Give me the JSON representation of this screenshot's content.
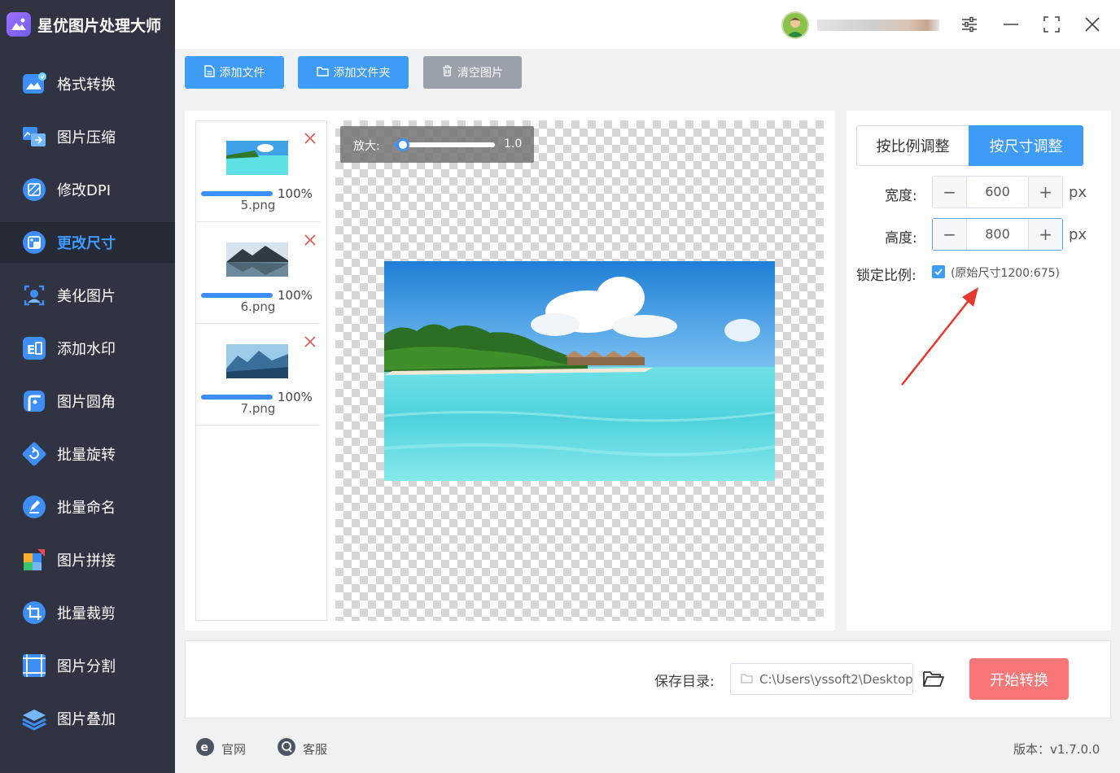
{
  "app": {
    "title": "星优图片处理大师",
    "accent": "#3e9bf6",
    "sidebar_bg": "#2f3342"
  },
  "sidebar": {
    "items": [
      {
        "label": "格式转换",
        "icon": "image-convert-icon"
      },
      {
        "label": "图片压缩",
        "icon": "image-compress-icon"
      },
      {
        "label": "修改DPI",
        "icon": "dpi-icon"
      },
      {
        "label": "更改尺寸",
        "icon": "resize-icon",
        "active": true
      },
      {
        "label": "美化图片",
        "icon": "beautify-icon"
      },
      {
        "label": "添加水印",
        "icon": "watermark-icon"
      },
      {
        "label": "图片圆角",
        "icon": "rounded-corner-icon"
      },
      {
        "label": "批量旋转",
        "icon": "rotate-icon"
      },
      {
        "label": "批量命名",
        "icon": "rename-icon"
      },
      {
        "label": "图片拼接",
        "icon": "puzzle-icon"
      },
      {
        "label": "批量裁剪",
        "icon": "crop-icon"
      },
      {
        "label": "图片分割",
        "icon": "split-icon"
      },
      {
        "label": "图片叠加",
        "icon": "layers-icon"
      }
    ]
  },
  "toolbar": {
    "add_file": "添加文件",
    "add_folder": "添加文件夹",
    "clear": "清空图片"
  },
  "files": [
    {
      "name": "5.png",
      "progress": "100%",
      "progress_value": 1.0
    },
    {
      "name": "6.png",
      "progress": "100%",
      "progress_value": 1.0
    },
    {
      "name": "7.png",
      "progress": "100%",
      "progress_value": 1.0
    }
  ],
  "zoom": {
    "label": "放大:",
    "value": "1.0"
  },
  "settings": {
    "tab_ratio": "按比例调整",
    "tab_size": "按尺寸调整",
    "width_label": "宽度:",
    "width_value": "600",
    "height_label": "高度:",
    "height_value": "800",
    "unit": "px",
    "lock_label": "锁定比例:",
    "lock_checked": true,
    "original_size": "(原始尺寸1200:675)"
  },
  "bottom": {
    "save_label": "保存目录:",
    "save_path": "C:\\Users\\yssoft2\\Desktop",
    "start_button": "开始转换"
  },
  "footer": {
    "website": "官网",
    "support": "客服",
    "version": "版本：v1.7.0.0"
  }
}
